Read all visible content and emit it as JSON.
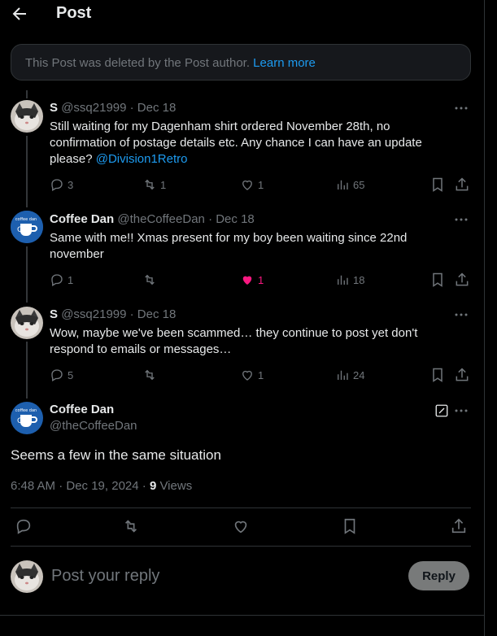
{
  "header": {
    "title": "Post"
  },
  "deleted_notice": {
    "text": "This Post was deleted by the Post author.",
    "link": "Learn more"
  },
  "replies": [
    {
      "name": "S",
      "handle": "@ssq21999",
      "date": "· Dec 18",
      "text": "Still waiting for my Dagenham shirt ordered November 28th, no confirmation of postage details etc. Any chance I can have an update please?",
      "mention": "@Division1Retro",
      "counts": {
        "replies": "3",
        "reposts": "1",
        "likes": "1",
        "views": "65"
      }
    },
    {
      "name": "Coffee Dan",
      "handle": "@theCoffeeDan",
      "date": "· Dec 18",
      "text": "Same with me!! Xmas present for my boy been waiting since 22nd november",
      "counts": {
        "replies": "1",
        "reposts": "",
        "likes": "1",
        "views": "18"
      }
    },
    {
      "name": "S",
      "handle": "@ssq21999",
      "date": "· Dec 18",
      "text": "Wow, maybe we've been scammed… they continue to post yet don't respond to emails or messages…",
      "counts": {
        "replies": "5",
        "reposts": "",
        "likes": "1",
        "views": "24"
      }
    }
  ],
  "main_post": {
    "name": "Coffee Dan",
    "handle": "@theCoffeeDan",
    "text": "Seems a few in the same situation",
    "timestamp": "6:48 AM · Dec 19, 2024 · ",
    "views_count": "9",
    "views_label": " Views"
  },
  "composer": {
    "placeholder": "Post your reply",
    "button": "Reply"
  },
  "colors": {
    "link": "#1d9bf0",
    "like_active": "#f91880",
    "muted": "#71767b"
  },
  "icons": [
    "back-arrow-icon",
    "more-icon",
    "reply-icon",
    "repost-icon",
    "like-icon",
    "views-icon",
    "bookmark-icon",
    "share-icon",
    "edit-icon"
  ]
}
